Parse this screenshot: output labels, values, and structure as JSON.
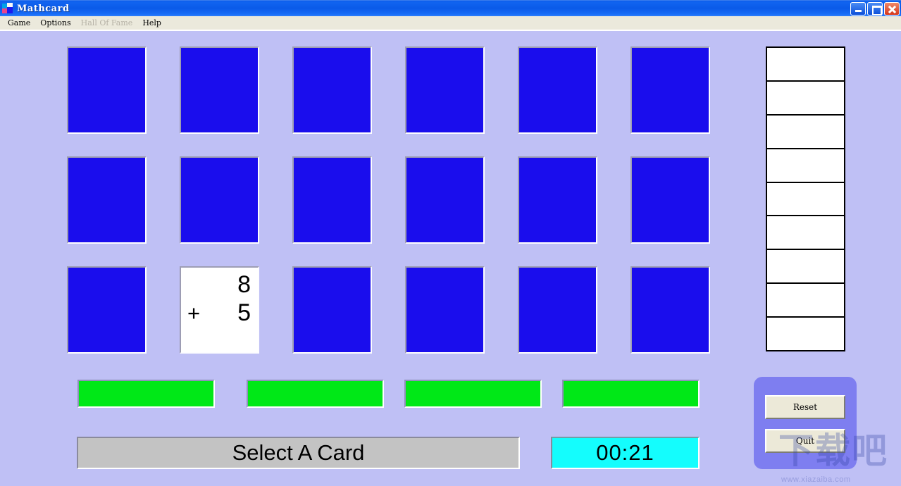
{
  "window": {
    "title": "Mathcard",
    "icon": "mathcard-logo-icon",
    "controls": {
      "minimize": "minimize-button",
      "maximize": "restore-button",
      "close": "close-button"
    }
  },
  "menubar": {
    "items": [
      {
        "label": "Game",
        "disabled": false
      },
      {
        "label": "Options",
        "disabled": false
      },
      {
        "label": "Hall Of Fame",
        "disabled": true
      },
      {
        "label": "Help",
        "disabled": false
      }
    ]
  },
  "board": {
    "rows": 3,
    "columns": 6,
    "card_back_color": "#1a0ded",
    "cards": [
      {
        "index": 0,
        "row": 0,
        "col": 0,
        "state": "face-down"
      },
      {
        "index": 1,
        "row": 0,
        "col": 1,
        "state": "face-down"
      },
      {
        "index": 2,
        "row": 0,
        "col": 2,
        "state": "face-down"
      },
      {
        "index": 3,
        "row": 0,
        "col": 3,
        "state": "face-down"
      },
      {
        "index": 4,
        "row": 0,
        "col": 4,
        "state": "face-down"
      },
      {
        "index": 5,
        "row": 0,
        "col": 5,
        "state": "face-down"
      },
      {
        "index": 6,
        "row": 1,
        "col": 0,
        "state": "face-down"
      },
      {
        "index": 7,
        "row": 1,
        "col": 1,
        "state": "face-down"
      },
      {
        "index": 8,
        "row": 1,
        "col": 2,
        "state": "face-down"
      },
      {
        "index": 9,
        "row": 1,
        "col": 3,
        "state": "face-down"
      },
      {
        "index": 10,
        "row": 1,
        "col": 4,
        "state": "face-down"
      },
      {
        "index": 11,
        "row": 1,
        "col": 5,
        "state": "face-down"
      },
      {
        "index": 12,
        "row": 2,
        "col": 0,
        "state": "face-down"
      },
      {
        "index": 13,
        "row": 2,
        "col": 1,
        "state": "face-up",
        "operand_top": "8",
        "operator": "+",
        "operand_bottom": "5"
      },
      {
        "index": 14,
        "row": 2,
        "col": 2,
        "state": "face-down"
      },
      {
        "index": 15,
        "row": 2,
        "col": 3,
        "state": "face-down"
      },
      {
        "index": 16,
        "row": 2,
        "col": 4,
        "state": "face-down"
      },
      {
        "index": 17,
        "row": 2,
        "col": 5,
        "state": "face-down"
      }
    ]
  },
  "score_panel": {
    "slot_count": 9,
    "slots": [
      "",
      "",
      "",
      "",
      "",
      "",
      "",
      "",
      ""
    ]
  },
  "progress_bars": {
    "count": 4,
    "color": "#00e817",
    "bars": [
      {
        "index": 0,
        "filled": true
      },
      {
        "index": 1,
        "filled": true
      },
      {
        "index": 2,
        "filled": true
      },
      {
        "index": 3,
        "filled": true
      }
    ]
  },
  "status": {
    "message": "Select A Card"
  },
  "timer": {
    "value": "00:21",
    "color": "#14fdfd"
  },
  "controls": {
    "reset_label": "Reset",
    "quit_label": "Quit"
  },
  "watermark": {
    "glyph": "下载吧",
    "url": "www.xiazaiba.com"
  }
}
